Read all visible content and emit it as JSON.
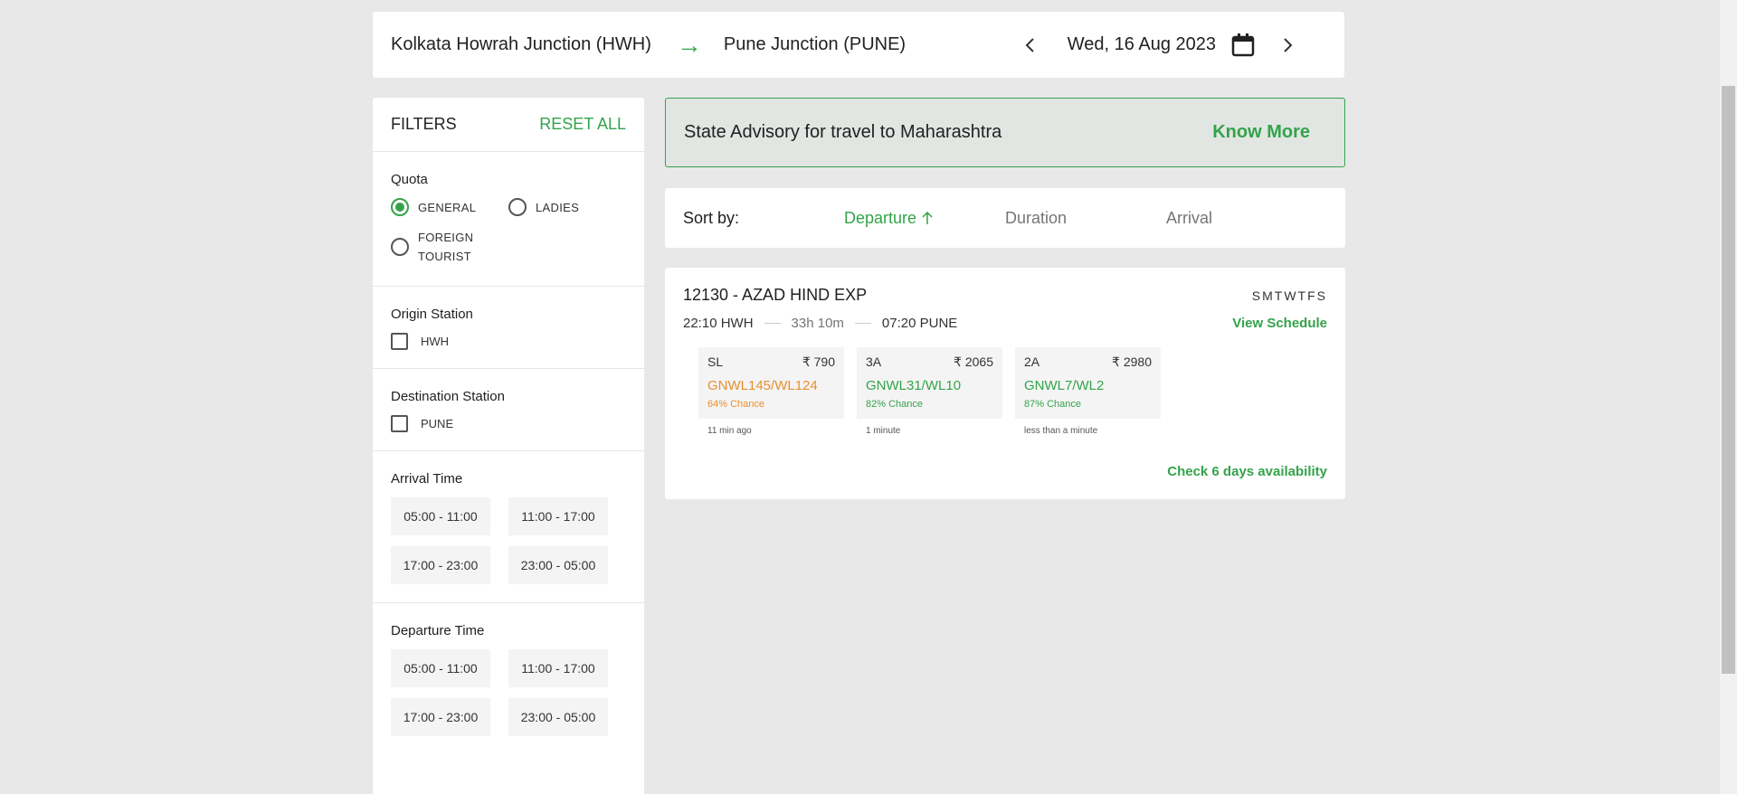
{
  "route": {
    "from": "Kolkata Howrah Junction (HWH)",
    "arrow": "→",
    "to": "Pune Junction (PUNE)",
    "date": "Wed, 16 Aug 2023"
  },
  "filters": {
    "title": "FILTERS",
    "reset_label": "RESET ALL",
    "quota": {
      "title": "Quota",
      "options": [
        {
          "label": "GENERAL",
          "selected": true
        },
        {
          "label": "LADIES",
          "selected": false
        },
        {
          "label": "FOREIGN TOURIST",
          "selected": false
        }
      ]
    },
    "origin": {
      "title": "Origin Station",
      "option": "HWH"
    },
    "destination": {
      "title": "Destination Station",
      "option": "PUNE"
    },
    "arrival_time": {
      "title": "Arrival Time",
      "slots": [
        "05:00 - 11:00",
        "11:00 - 17:00",
        "17:00 - 23:00",
        "23:00 - 05:00"
      ]
    },
    "departure_time": {
      "title": "Departure Time",
      "slots": [
        "05:00 - 11:00",
        "11:00 - 17:00",
        "17:00 - 23:00",
        "23:00 - 05:00"
      ]
    }
  },
  "advisory": {
    "text": "State Advisory for travel to Maharashtra",
    "link": "Know More"
  },
  "sort": {
    "label": "Sort by:",
    "options": [
      "Departure",
      "Duration",
      "Arrival"
    ],
    "active": "Departure"
  },
  "train": {
    "name": "12130 - AZAD HIND EXP",
    "days": "SMTWTFS",
    "dep": "22:10 HWH",
    "duration": "33h 10m",
    "arr": "07:20 PUNE",
    "view_schedule": "View Schedule",
    "classes": [
      {
        "code": "SL",
        "price": "₹ 790",
        "avail": "GNWL145/WL124",
        "chance": "64% Chance",
        "updated": "11 min ago",
        "tone": "orange"
      },
      {
        "code": "3A",
        "price": "₹ 2065",
        "avail": "GNWL31/WL10",
        "chance": "82% Chance",
        "updated": "1 minute",
        "tone": "green"
      },
      {
        "code": "2A",
        "price": "₹ 2980",
        "avail": "GNWL7/WL2",
        "chance": "87% Chance",
        "updated": "less than a minute",
        "tone": "green"
      }
    ],
    "check_days": "Check 6 days availability"
  },
  "colors": {
    "accent": "#33a34a",
    "warning": "#e8902d",
    "background": "#e8e8e8"
  }
}
